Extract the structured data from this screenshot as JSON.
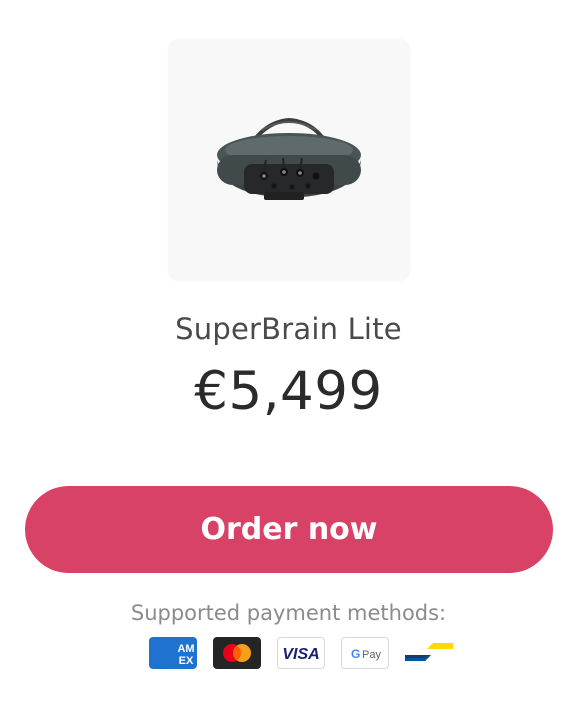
{
  "product": {
    "name": "SuperBrain Lite",
    "price": "€5,499",
    "image_icon": "eeg-headset-icon"
  },
  "order_button": {
    "label": "Order now",
    "color": "#d84266"
  },
  "payment": {
    "label": "Supported payment methods:",
    "methods": [
      {
        "icon": "amex-icon",
        "text": "AM EX"
      },
      {
        "icon": "mastercard-icon"
      },
      {
        "icon": "visa-icon",
        "text": "VISA"
      },
      {
        "icon": "google-pay-icon",
        "text": "G Pay"
      },
      {
        "icon": "bancontact-icon"
      }
    ]
  }
}
